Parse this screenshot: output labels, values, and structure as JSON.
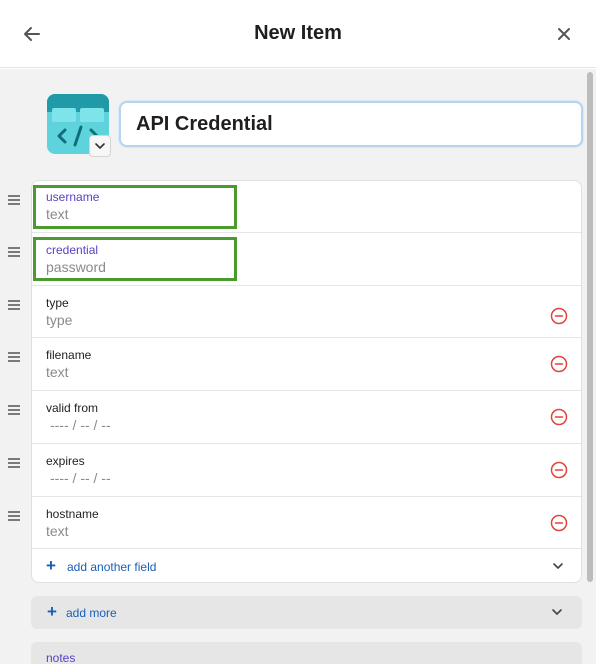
{
  "header": {
    "title": "New Item",
    "back_icon": "arrow-left-icon",
    "close_icon": "close-icon"
  },
  "item": {
    "icon": "api-code-icon",
    "title_value": "API Credential"
  },
  "fields": [
    {
      "label": "username",
      "value": "text",
      "label_color": "#5b3fc4",
      "highlighted": true,
      "removable": false
    },
    {
      "label": "credential",
      "value": "password",
      "label_color": "#5b3fc4",
      "highlighted": true,
      "removable": false
    },
    {
      "label": "type",
      "value": "type",
      "removable": true
    },
    {
      "label": "filename",
      "value": "text",
      "removable": true
    },
    {
      "label": "valid from",
      "value": "---- / -- / --",
      "removable": true
    },
    {
      "label": "expires",
      "value": "---- / -- / --",
      "removable": true
    },
    {
      "label": "hostname",
      "value": "text",
      "removable": true
    }
  ],
  "add_field": {
    "label": "add another field"
  },
  "add_more": {
    "label": "add more"
  },
  "notes": {
    "label": "notes"
  },
  "colors": {
    "accent_blue": "#1a5fb4",
    "label_purple": "#5b3fc4",
    "remove_red": "#e0443a",
    "highlight_green": "#4a9a2f",
    "icon_teal": "#1f9aa6"
  }
}
